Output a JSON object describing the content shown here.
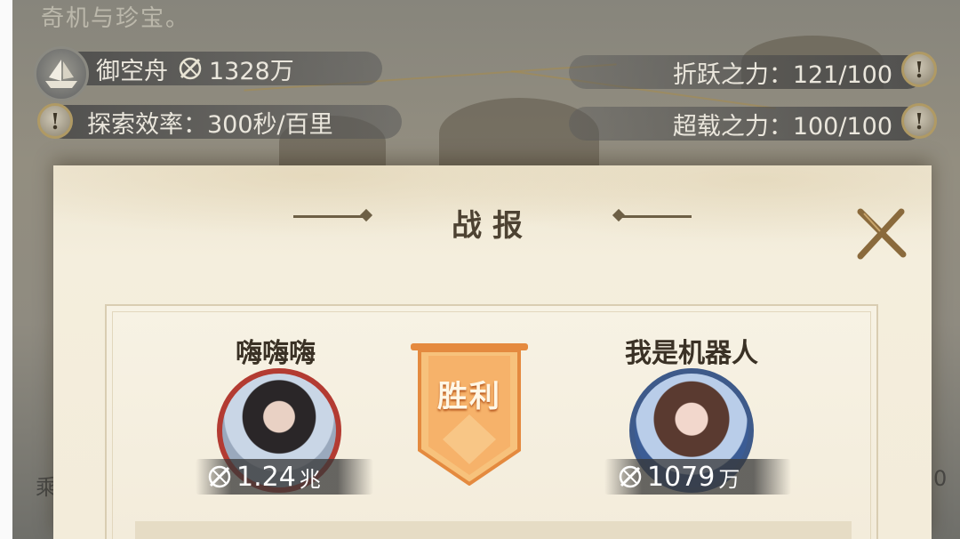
{
  "background": {
    "top_text": "奇机与珍宝。",
    "ship": {
      "name": "御空舟",
      "power": "1328万"
    },
    "explore": {
      "label": "探索效率：300秒/百里"
    },
    "stats": [
      {
        "label": "折跃之力：121/100"
      },
      {
        "label": "超载之力：100/100"
      }
    ],
    "info_glyph": "!",
    "left_edge_char": "乘",
    "right_edge_char": "0"
  },
  "modal": {
    "title": "战报",
    "close_glyph": "✕",
    "result": "胜利",
    "players": [
      {
        "name": "嗨嗨嗨",
        "power_value": "1.24",
        "power_unit": "兆",
        "frame_color": "#b33b32"
      },
      {
        "name": "我是机器人",
        "power_value": "1079",
        "power_unit": "万",
        "frame_color": "#3e5a8a"
      }
    ]
  },
  "colors": {
    "banner_orange": "#f1a45c",
    "parchment": "#f3ecda",
    "title_brown": "#4d4232"
  },
  "icons": [
    "ship-icon",
    "sword-power-icon",
    "info-icon",
    "close-icon",
    "victory-banner-icon"
  ]
}
